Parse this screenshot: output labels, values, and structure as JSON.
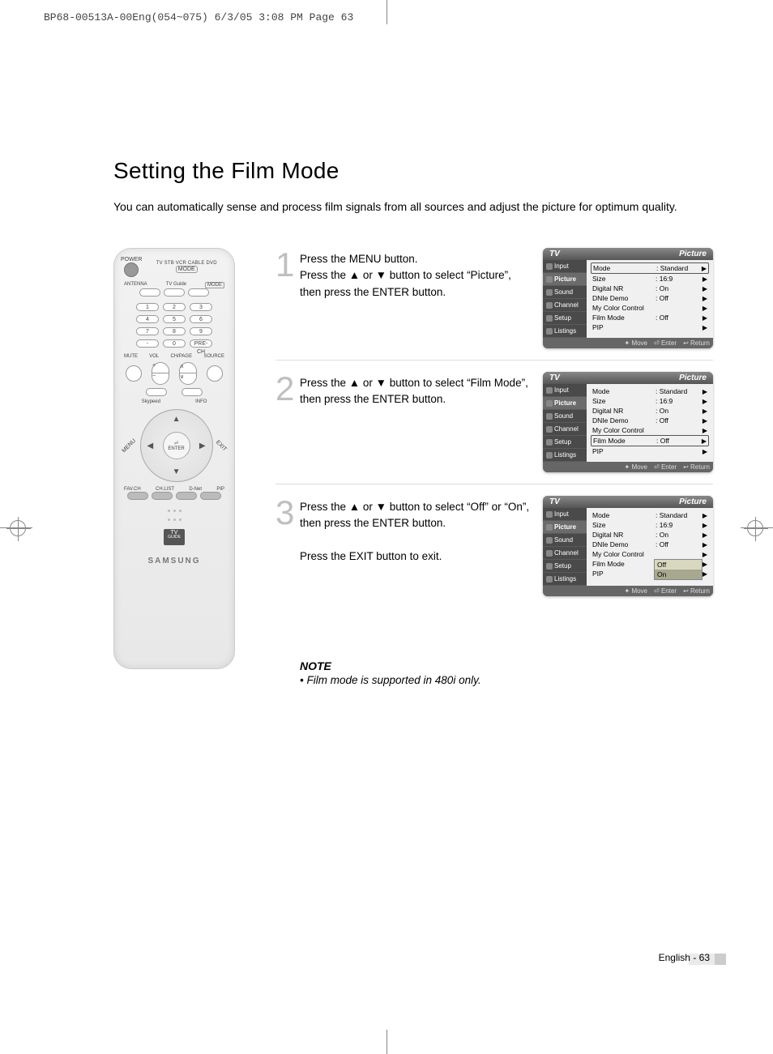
{
  "header_line": "BP68-00513A-00Eng(054~075)  6/3/05  3:08 PM  Page 63",
  "title": "Setting the Film Mode",
  "intro": "You can automatically sense and process film signals from all sources and adjust the picture for optimum quality.",
  "remote": {
    "power_label": "POWER",
    "mode_line": "TV  STB  VCR  CABLE  DVD",
    "mode_caption": "MODE",
    "row_labels_top": [
      "ANTENNA",
      "TV Guide",
      "MODE"
    ],
    "numpad": [
      "1",
      "2",
      "3",
      "4",
      "5",
      "6",
      "7",
      "8",
      "9",
      "-",
      "0",
      "PRE-CH"
    ],
    "mid_labels": [
      "MUTE",
      "VOL",
      "CH/PAGE",
      "SOURCE"
    ],
    "small_btns": [
      "Skypeed",
      "INFO"
    ],
    "diag_left": "MENU",
    "diag_right": "EXIT",
    "enter_symbol": "⏎",
    "enter_label": "ENTER",
    "bottom_row": [
      "FAV.CH",
      "CH.LIST",
      "D-Net",
      "PIP"
    ],
    "brand": "SAMSUNG",
    "tvguide_top": "TV",
    "tvguide_bottom": "GUIDE"
  },
  "steps": [
    {
      "num": "1",
      "text": "Press the MENU button.\nPress the ▲ or ▼ button to select “Picture”, then press the ENTER button.",
      "osd": {
        "title_left": "TV",
        "title_right": "Picture",
        "side": [
          "Input",
          "Picture",
          "Sound",
          "Channel",
          "Setup",
          "Listings"
        ],
        "side_sel": 1,
        "rows": [
          {
            "k": "Mode",
            "v": ": Standard",
            "sel": true
          },
          {
            "k": "Size",
            "v": ": 16:9"
          },
          {
            "k": "Digital NR",
            "v": ": On"
          },
          {
            "k": "DNIe Demo",
            "v": ": Off"
          },
          {
            "k": "My Color Control",
            "v": ""
          },
          {
            "k": "Film Mode",
            "v": ": Off"
          },
          {
            "k": "PIP",
            "v": ""
          }
        ],
        "foot": [
          "Move",
          "Enter",
          "Return"
        ]
      }
    },
    {
      "num": "2",
      "text": "Press the ▲ or ▼ button to select “Film Mode”, then press the ENTER button.",
      "osd": {
        "title_left": "TV",
        "title_right": "Picture",
        "side": [
          "Input",
          "Picture",
          "Sound",
          "Channel",
          "Setup",
          "Listings"
        ],
        "side_sel": 1,
        "rows": [
          {
            "k": "Mode",
            "v": ": Standard"
          },
          {
            "k": "Size",
            "v": ": 16:9"
          },
          {
            "k": "Digital NR",
            "v": ": On"
          },
          {
            "k": "DNIe Demo",
            "v": ": Off"
          },
          {
            "k": "My Color Control",
            "v": ""
          },
          {
            "k": "Film Mode",
            "v": ": Off",
            "sel": true
          },
          {
            "k": "PIP",
            "v": ""
          }
        ],
        "foot": [
          "Move",
          "Enter",
          "Return"
        ]
      }
    },
    {
      "num": "3",
      "text": "Press the ▲ or ▼ button to select “Off” or “On”, then press the ENTER button.\n\nPress the EXIT button to exit.",
      "osd": {
        "title_left": "TV",
        "title_right": "Picture",
        "side": [
          "Input",
          "Picture",
          "Sound",
          "Channel",
          "Setup",
          "Listings"
        ],
        "side_sel": 1,
        "rows": [
          {
            "k": "Mode",
            "v": ": Standard"
          },
          {
            "k": "Size",
            "v": ": 16:9"
          },
          {
            "k": "Digital NR",
            "v": ": On"
          },
          {
            "k": "DNIe Demo",
            "v": ": Off"
          },
          {
            "k": "My Color Control",
            "v": ""
          },
          {
            "k": "Film Mode",
            "v": ""
          },
          {
            "k": "PIP",
            "v": ""
          }
        ],
        "options": [
          "Off",
          "On"
        ],
        "option_sel": 1,
        "foot": [
          "Move",
          "Enter",
          "Return"
        ]
      }
    }
  ],
  "note_title": "NOTE",
  "note_bullet": "•  Film mode is supported in 480i only.",
  "page_num": "English - 63",
  "foot_icons": {
    "move": "✦",
    "enter": "⏎",
    "return": "↩"
  }
}
